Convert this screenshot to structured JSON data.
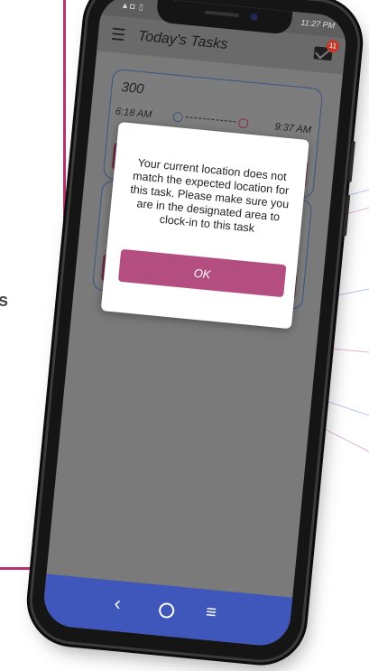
{
  "background": {
    "text_fragment": "s"
  },
  "status_bar": {
    "left_icons": "▲◘ ▯",
    "time": "11:27 PM"
  },
  "app_bar": {
    "title": "Today's Tasks",
    "menu_icon": "hamburger-menu-icon",
    "mail_icon": "mail-icon",
    "notification_count": "11"
  },
  "task_card": {
    "name": "300",
    "start_time": "6:18 AM",
    "end_time": "9:37 AM"
  },
  "dialog": {
    "message": "Your current location does not match the expected location for this task. Please make sure you are in the designated area to clock-in to this task",
    "ok_label": "OK"
  },
  "nav_bar": {
    "back_icon": "back-chevron-icon",
    "home_icon": "home-circle-icon",
    "menu_icon": "recent-apps-icon"
  },
  "colors": {
    "accent": "#b54e80",
    "card_border": "#3b5487",
    "nav_bar": "#3f56bb",
    "decor_line": "#b8336a"
  }
}
